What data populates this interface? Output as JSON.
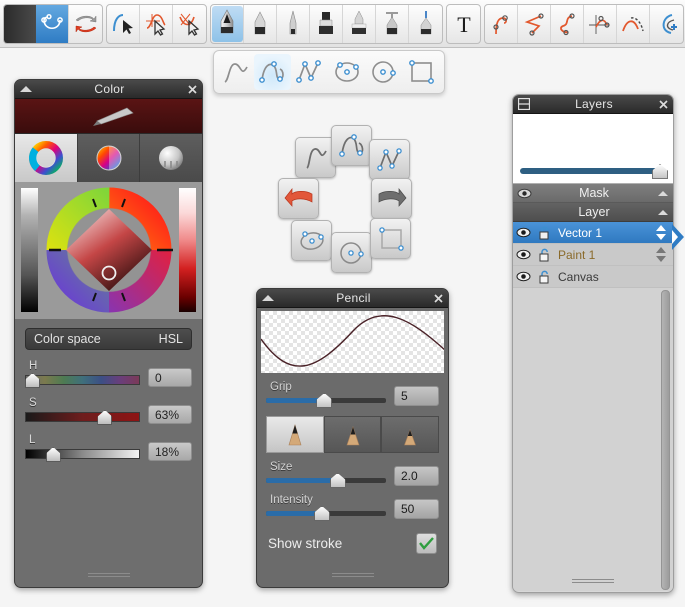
{
  "app": {
    "name": "vector-paint-app"
  },
  "toolbar": {
    "groups": [
      {
        "name": "history-group",
        "buttons": [
          {
            "name": "path-node-tool",
            "icon": "bezier-curve-icon",
            "selected": true
          },
          {
            "name": "undo-redo-button",
            "icon": "undo-redo-arrows-icon",
            "selected": false
          }
        ]
      },
      {
        "name": "selection-group",
        "buttons": [
          {
            "name": "select-path-tool",
            "icon": "curve-arrow-select-icon",
            "selected": false
          },
          {
            "name": "select-node-tool",
            "icon": "node-select-icon",
            "selected": false
          },
          {
            "name": "select-handle-tool",
            "icon": "handle-select-icon",
            "selected": false
          }
        ]
      },
      {
        "name": "brush-group",
        "buttons": [
          {
            "name": "pencil-tool",
            "icon": "pencil-icon",
            "selected": true
          },
          {
            "name": "crayon-tool",
            "icon": "crayon-icon",
            "selected": false
          },
          {
            "name": "pen-nib-tool",
            "icon": "pen-nib-icon",
            "selected": false
          },
          {
            "name": "marker-tool",
            "icon": "marker-icon",
            "selected": false
          },
          {
            "name": "airbrush-tool",
            "icon": "airbrush-icon",
            "selected": false
          },
          {
            "name": "spray-tool",
            "icon": "spray-can-icon",
            "selected": false
          },
          {
            "name": "ink-pen-tool",
            "icon": "ink-pen-icon",
            "selected": false
          }
        ]
      },
      {
        "name": "text-group",
        "buttons": [
          {
            "name": "text-tool",
            "icon": "text-t-icon",
            "selected": false
          }
        ]
      },
      {
        "name": "vector-edit-group",
        "buttons": [
          {
            "name": "add-node-tool",
            "icon": "add-node-icon",
            "selected": false
          },
          {
            "name": "delete-node-tool",
            "icon": "delete-node-icon",
            "selected": false
          },
          {
            "name": "split-path-tool",
            "icon": "split-path-icon",
            "selected": false
          },
          {
            "name": "transform-node-tool",
            "icon": "transform-node-icon",
            "selected": false
          },
          {
            "name": "smooth-path-tool",
            "icon": "smooth-path-icon",
            "selected": false
          },
          {
            "name": "add-path-tool",
            "icon": "add-path-plus-icon",
            "selected": false
          }
        ]
      }
    ]
  },
  "subtoolbar": {
    "name": "shape-flyout",
    "buttons": [
      {
        "name": "freehand-curve-shape",
        "icon": "freehand-curve-icon",
        "selected": false
      },
      {
        "name": "bezier-curve-shape",
        "icon": "bezier-nodes-icon",
        "selected": true
      },
      {
        "name": "polyline-shape",
        "icon": "polyline-nodes-icon",
        "selected": false
      },
      {
        "name": "ellipse-shape",
        "icon": "ellipse-nodes-icon",
        "selected": false
      },
      {
        "name": "circle-shape",
        "icon": "circle-nodes-icon",
        "selected": false
      },
      {
        "name": "rectangle-shape",
        "icon": "rectangle-nodes-icon",
        "selected": false
      }
    ]
  },
  "radial_menu": {
    "name": "radial-shape-menu",
    "items": [
      {
        "name": "radial-freehand-curve",
        "icon": "freehand-curve-icon"
      },
      {
        "name": "radial-bezier-curve",
        "icon": "bezier-nodes-icon"
      },
      {
        "name": "radial-polyline",
        "icon": "polyline-nodes-icon"
      },
      {
        "name": "radial-undo",
        "icon": "undo-arrow-red-icon"
      },
      {
        "name": "radial-redo",
        "icon": "redo-arrow-gray-icon"
      },
      {
        "name": "radial-ellipse",
        "icon": "ellipse-nodes-icon"
      },
      {
        "name": "radial-circle",
        "icon": "circle-nodes-icon"
      },
      {
        "name": "radial-rectangle",
        "icon": "rectangle-nodes-icon"
      }
    ]
  },
  "color_panel": {
    "title": "Color",
    "collapse_icon": "collapse-triangle-icon",
    "close_icon": "close-x-icon",
    "swatch": {
      "name": "current-color-swatch",
      "hex": "#4a1010",
      "icon": "eyedropper-icon"
    },
    "tabs": [
      {
        "name": "color-wheel-tab",
        "icon": "color-ring-icon",
        "selected": true
      },
      {
        "name": "color-disc-tab",
        "icon": "color-disc-icon",
        "selected": false
      },
      {
        "name": "color-sphere-tab",
        "icon": "gray-sphere-icon",
        "selected": false
      }
    ],
    "wheel": {
      "name": "hsl-color-wheel",
      "marker_icon": "color-marker-ring-icon"
    },
    "colorspace": {
      "label": "Color space",
      "value": "HSL"
    },
    "sliders": [
      {
        "name": "hue-slider",
        "label": "H",
        "value": "0",
        "pos_pct": 2
      },
      {
        "name": "saturation-slider",
        "label": "S",
        "value": "63%",
        "pos_pct": 63
      },
      {
        "name": "lightness-slider",
        "label": "L",
        "value": "18%",
        "pos_pct": 18
      }
    ]
  },
  "pencil_panel": {
    "title": "Pencil",
    "collapse_icon": "collapse-triangle-icon",
    "close_icon": "close-x-icon",
    "preview": {
      "name": "stroke-preview",
      "stroke_hex": "#4a2228"
    },
    "grip": {
      "label": "Grip",
      "value": "5",
      "pos_pct": 46
    },
    "tips": [
      {
        "name": "pencil-tip-soft",
        "icon": "pencil-tip-icon",
        "selected": true
      },
      {
        "name": "pencil-tip-medium",
        "icon": "pencil-tip-icon",
        "selected": false
      },
      {
        "name": "pencil-tip-hard",
        "icon": "pencil-tip-icon",
        "selected": false
      }
    ],
    "size": {
      "label": "Size",
      "value": "2.0",
      "pos_pct": 57
    },
    "intensity": {
      "label": "Intensity",
      "value": "50",
      "pos_pct": 44
    },
    "show_stroke": {
      "label": "Show stroke",
      "checked": true,
      "icon": "checkmark-icon"
    }
  },
  "layers_panel": {
    "title": "Layers",
    "menu_icon": "panel-menu-icon",
    "close_icon": "close-x-icon",
    "opacity_slider": {
      "name": "layer-opacity-slider",
      "pos_pct": 96
    },
    "sections": [
      {
        "name": "mask-section-header",
        "label": "Mask",
        "eye_icon": "eye-icon",
        "caret_icon": "collapse-triangle-icon"
      },
      {
        "name": "layer-section-header",
        "label": "Layer",
        "caret_icon": "collapse-triangle-icon"
      }
    ],
    "rows": [
      {
        "name": "layer-row-vector-1",
        "label": "Vector 1",
        "eye_icon": "eye-icon",
        "lock_icon": "unlocked-icon",
        "arrows_icon": "updown-arrows-icon",
        "selected": true
      },
      {
        "name": "layer-row-paint-1",
        "label": "Paint 1",
        "eye_icon": "eye-icon",
        "lock_icon": "unlocked-icon",
        "arrows_icon": "updown-arrows-icon",
        "selected": false
      },
      {
        "name": "layer-row-canvas",
        "label": "Canvas",
        "eye_icon": "eye-icon",
        "lock_icon": "unlocked-icon",
        "arrows_icon": "",
        "selected": false
      }
    ],
    "scrollbar": {
      "name": "layers-scrollbar"
    }
  },
  "right_tab": {
    "name": "expand-right-panel-tab",
    "icon": "chevron-right-icon"
  },
  "colors": {
    "accent_blue": "#2f7cc4",
    "swatch_red": "#4a1010",
    "panel_gray": "#6e6e6e",
    "title_dark": "#2a2a2a"
  }
}
